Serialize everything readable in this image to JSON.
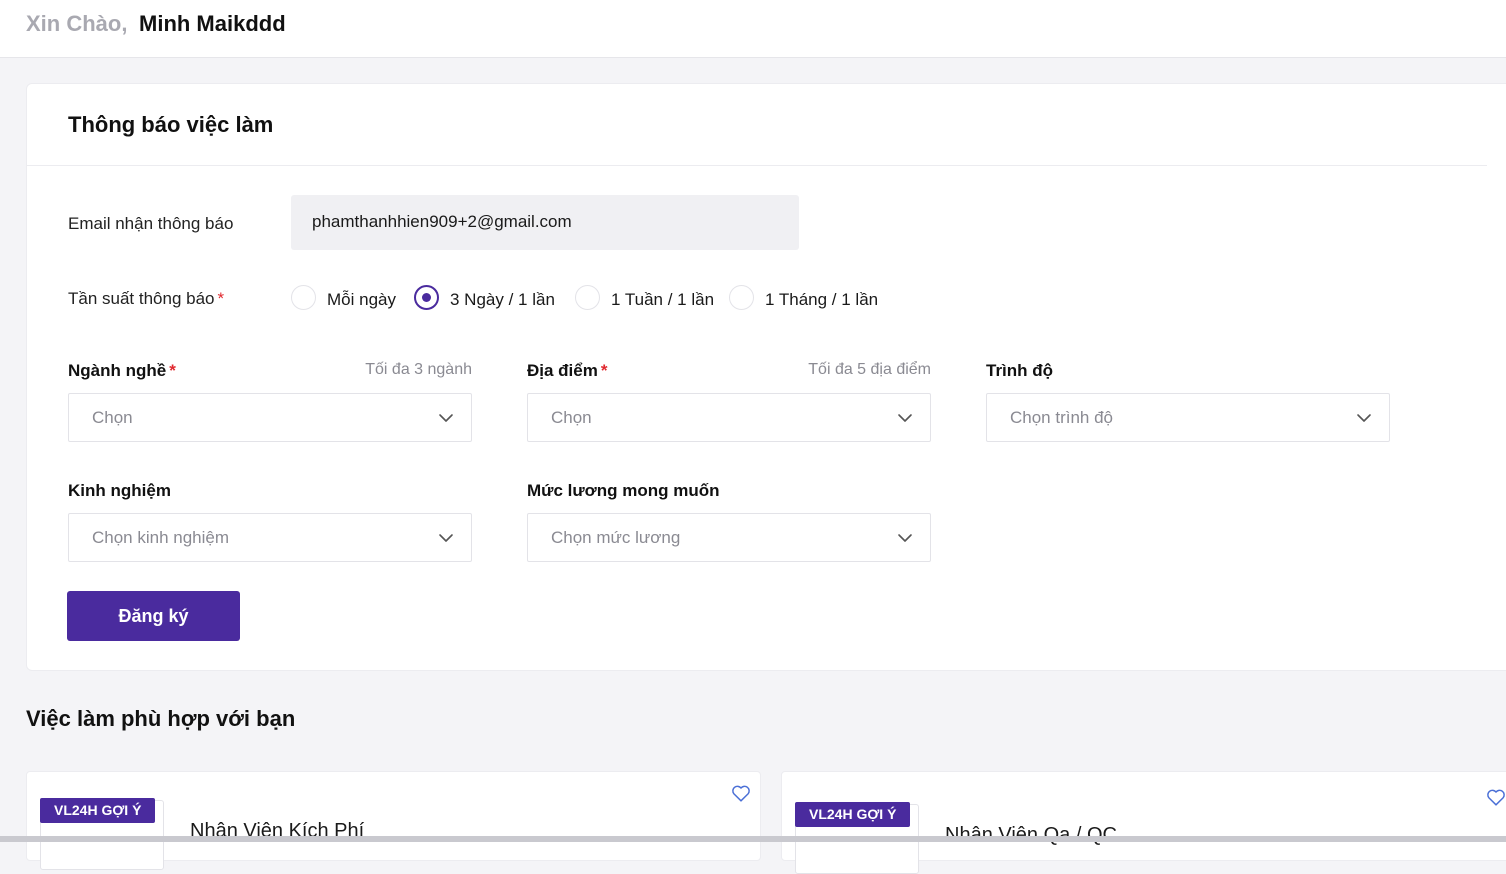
{
  "header": {
    "greeting": "Xin Chào,",
    "user_name": "Minh Maikddd"
  },
  "alert_form": {
    "title": "Thông báo việc làm",
    "email": {
      "label": "Email nhận thông báo",
      "value": "phamthanhhien909+2@gmail.com"
    },
    "frequency": {
      "label": "Tần suất thông báo",
      "required_mark": "*",
      "options": [
        "Mỗi ngày",
        "3 Ngày / 1 lần",
        "1 Tuần / 1 lần",
        "1 Tháng / 1 lần"
      ],
      "selected": "3 Ngày / 1 lần"
    },
    "industry": {
      "label": "Ngành nghề",
      "required_mark": "*",
      "hint": "Tối đa 3 ngành",
      "placeholder": "Chọn"
    },
    "location": {
      "label": "Địa điểm",
      "required_mark": "*",
      "hint": "Tối đa 5 địa điểm",
      "placeholder": "Chọn"
    },
    "education": {
      "label": "Trình độ",
      "placeholder": "Chọn trình độ"
    },
    "experience": {
      "label": "Kinh nghiệm",
      "placeholder": "Chọn kinh nghiệm"
    },
    "salary": {
      "label": "Mức lương mong muốn",
      "placeholder": "Chọn mức lương"
    },
    "submit_label": "Đăng ký"
  },
  "suggested": {
    "title": "Việc làm phù hợp với bạn",
    "jobs": [
      {
        "badge": "VL24H GỢI Ý",
        "title": "Nhân Viên Kích Phí"
      },
      {
        "badge": "VL24H GỢI Ý",
        "title": "Nhân Viên Qa / QC"
      }
    ]
  },
  "colors": {
    "accent": "#4a2b9e",
    "required": "#e0282e",
    "muted": "#8a8a92"
  }
}
